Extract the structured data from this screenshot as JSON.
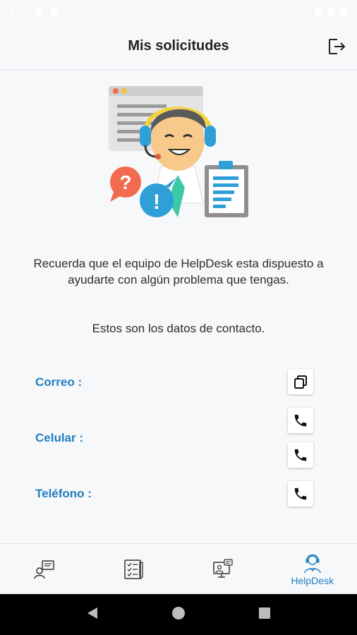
{
  "status_bar": {
    "time": "6:20"
  },
  "header": {
    "title": "Mis solicitudes",
    "logout_icon": "logout-icon"
  },
  "hero": {
    "illustration": "helpdesk-agent-illustration"
  },
  "message": {
    "text": "Recuerda que el equipo de HelpDesk esta dispuesto a ayudarte con algún problema que tengas.",
    "contact_note": "Estos son los datos de contacto."
  },
  "contacts": {
    "email_label": "Correo :",
    "cell_label": "Celular :",
    "phone_label": "Teléfono :"
  },
  "bottom_nav": {
    "items": [
      {
        "icon": "requests-icon",
        "label": ""
      },
      {
        "icon": "checklist-icon",
        "label": ""
      },
      {
        "icon": "monitor-support-icon",
        "label": ""
      },
      {
        "icon": "helpdesk-icon",
        "label": "HelpDesk",
        "active": true
      }
    ]
  },
  "colors": {
    "accent": "#1f7fbf",
    "background": "#f7f8fa",
    "system_nav": "#000000"
  }
}
